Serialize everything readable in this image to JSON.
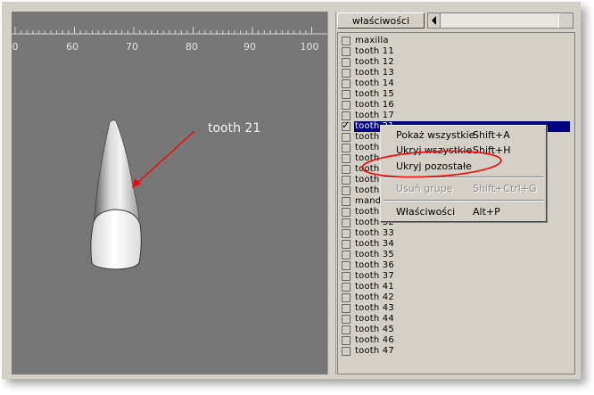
{
  "viewport": {
    "ruler_ticks": [
      "0",
      "60",
      "70",
      "80",
      "90",
      "100"
    ],
    "annotation_label": "tooth 21",
    "colors": {
      "background": "#777777",
      "arrow": "#ff0000"
    }
  },
  "toolbar": {
    "properties_button": "właściwości"
  },
  "structure_list": {
    "items": [
      {
        "label": "maxilla",
        "checked": false,
        "selected": false
      },
      {
        "label": "tooth 11",
        "checked": false,
        "selected": false
      },
      {
        "label": "tooth 12",
        "checked": false,
        "selected": false
      },
      {
        "label": "tooth 13",
        "checked": false,
        "selected": false
      },
      {
        "label": "tooth 14",
        "checked": false,
        "selected": false
      },
      {
        "label": "tooth 15",
        "checked": false,
        "selected": false
      },
      {
        "label": "tooth 16",
        "checked": false,
        "selected": false
      },
      {
        "label": "tooth 17",
        "checked": false,
        "selected": false
      },
      {
        "label": "tooth 21",
        "checked": true,
        "selected": true
      },
      {
        "label": "tooth",
        "checked": false,
        "selected": false
      },
      {
        "label": "tooth",
        "checked": false,
        "selected": false
      },
      {
        "label": "tooth",
        "checked": false,
        "selected": false
      },
      {
        "label": "tooth",
        "checked": false,
        "selected": false
      },
      {
        "label": "tooth",
        "checked": false,
        "selected": false
      },
      {
        "label": "tooth",
        "checked": false,
        "selected": false
      },
      {
        "label": "mand",
        "checked": false,
        "selected": false
      },
      {
        "label": "tooth",
        "checked": false,
        "selected": false
      },
      {
        "label": "tooth 32",
        "checked": false,
        "selected": false
      },
      {
        "label": "tooth 33",
        "checked": false,
        "selected": false
      },
      {
        "label": "tooth 34",
        "checked": false,
        "selected": false
      },
      {
        "label": "tooth 35",
        "checked": false,
        "selected": false
      },
      {
        "label": "tooth 36",
        "checked": false,
        "selected": false
      },
      {
        "label": "tooth 37",
        "checked": false,
        "selected": false
      },
      {
        "label": "tooth 41",
        "checked": false,
        "selected": false
      },
      {
        "label": "tooth 42",
        "checked": false,
        "selected": false
      },
      {
        "label": "tooth 43",
        "checked": false,
        "selected": false
      },
      {
        "label": "tooth 44",
        "checked": false,
        "selected": false
      },
      {
        "label": "tooth 45",
        "checked": false,
        "selected": false
      },
      {
        "label": "tooth 46",
        "checked": false,
        "selected": false
      },
      {
        "label": "tooth 47",
        "checked": false,
        "selected": false
      }
    ],
    "check_mark": "✓",
    "selection_color": "#000080"
  },
  "context_menu": {
    "items": [
      {
        "label": "Pokaż wszystkie",
        "shortcut": "Shift+A",
        "enabled": true
      },
      {
        "label": "Ukryj wszystkie",
        "shortcut": "Shift+H",
        "enabled": true
      },
      {
        "label": "Ukryj pozostałe",
        "shortcut": "",
        "enabled": true
      },
      {
        "label": "Usuń grupę",
        "shortcut": "Shift+Ctrl+G",
        "enabled": false
      },
      {
        "label": "Właściwości",
        "shortcut": "Alt+P",
        "enabled": true
      }
    ],
    "highlight_ellipse_color": "#ff0000"
  }
}
